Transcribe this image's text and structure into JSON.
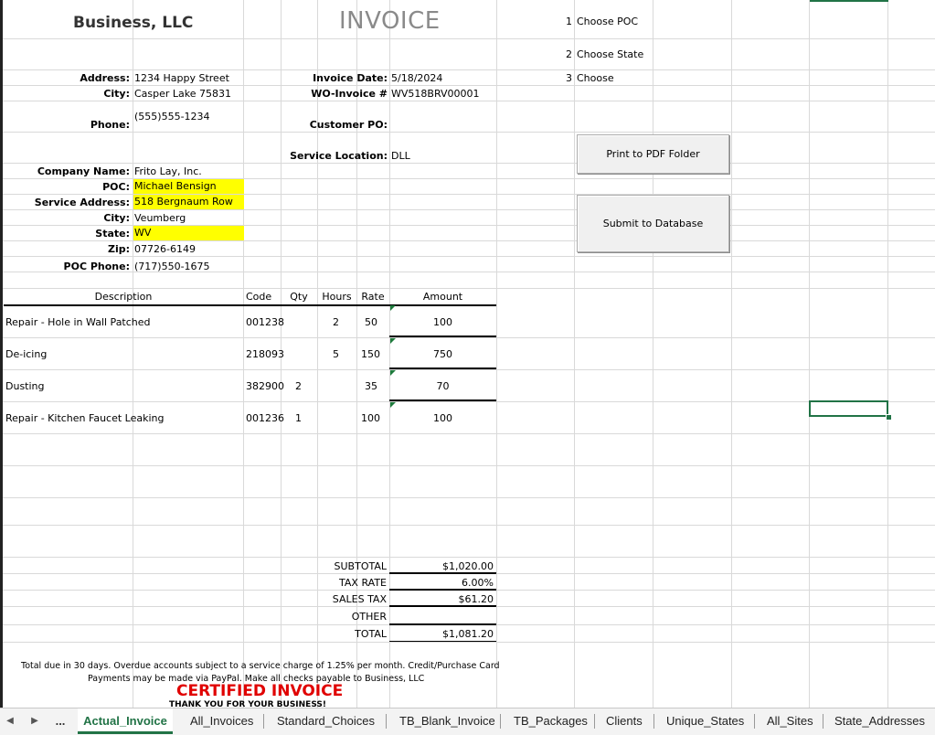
{
  "header": {
    "business": "Business, LLC",
    "invoice_title": "INVOICE"
  },
  "address": {
    "address_label": "Address:",
    "address_value": "1234 Happy Street",
    "city_label": "City:",
    "city_value": "Casper Lake 75831",
    "phone_label": "Phone:",
    "phone_value": "(555)555-1234"
  },
  "invoice_meta": {
    "date_label": "Invoice Date:",
    "date_value": "5/18/2024",
    "wo_label": "WO-Invoice #",
    "wo_value": "WV518BRV00001",
    "po_label": "Customer PO:",
    "po_value": "",
    "location_label": "Service Location:",
    "location_value": "DLL"
  },
  "customer": {
    "company_label": "Company Name:",
    "company_value": "Frito Lay, Inc.",
    "poc_label": "POC:",
    "poc_value": "Michael Bensign",
    "service_address_label": "Service Address:",
    "service_address_value": "518 Bergnaum Row",
    "city_label": "City:",
    "city_value": "Veumberg",
    "state_label": "State:",
    "state_value": "WV",
    "zip_label": "Zip:",
    "zip_value": "07726-6149",
    "poc_phone_label": "POC Phone:",
    "poc_phone_value": "(717)550-1675"
  },
  "choices": {
    "n1": "1",
    "t1": "Choose POC",
    "n2": "2",
    "t2": "Choose State",
    "n3": "3",
    "t3": "Choose"
  },
  "buttons": {
    "print": "Print to PDF Folder",
    "submit": "Submit to Database"
  },
  "table": {
    "headers": {
      "description": "Description",
      "code": "Code",
      "qty": "Qty",
      "hours": "Hours",
      "rate": "Rate",
      "amount": "Amount"
    },
    "rows": [
      {
        "description": "Repair - Hole in Wall Patched",
        "code": "001238",
        "qty": "",
        "hours": "2",
        "rate": "50",
        "amount": "100"
      },
      {
        "description": "De-icing",
        "code": "218093",
        "qty": "",
        "hours": "5",
        "rate": "150",
        "amount": "750"
      },
      {
        "description": "Dusting",
        "code": "382900",
        "qty": "2",
        "hours": "",
        "rate": "35",
        "amount": "70"
      },
      {
        "description": "Repair - Kitchen Faucet Leaking",
        "code": "001236",
        "qty": "1",
        "hours": "",
        "rate": "100",
        "amount": "100"
      }
    ]
  },
  "totals": {
    "subtotal_label": "SUBTOTAL",
    "subtotal_value": "$1,020.00",
    "tax_rate_label": "TAX RATE",
    "tax_rate_value": "6.00%",
    "sales_tax_label": "SALES TAX",
    "sales_tax_value": "$61.20",
    "other_label": "OTHER",
    "other_value": "",
    "total_label": "TOTAL",
    "total_value": "$1,081.20"
  },
  "footer": {
    "line1": "Total due in 30 days. Overdue accounts subject to a service charge of 1.25% per month. Credit/Purchase Card",
    "line2": "Payments may be made via PayPal. Make all checks payable to Business, LLC",
    "certified": "CERTIFIED INVOICE",
    "thanks": "THANK YOU FOR YOUR BUSINESS!"
  },
  "tabs": {
    "ellipsis": "...",
    "items": [
      "Actual_Invoice",
      "All_Invoices",
      "Standard_Choices",
      "TB_Blank_Invoice",
      "TB_Packages",
      "Clients",
      "Unique_States",
      "All_Sites",
      "State_Addresses"
    ]
  },
  "colors": {
    "highlight": "#ffff00",
    "accent": "#217346",
    "certified": "#e00000"
  }
}
